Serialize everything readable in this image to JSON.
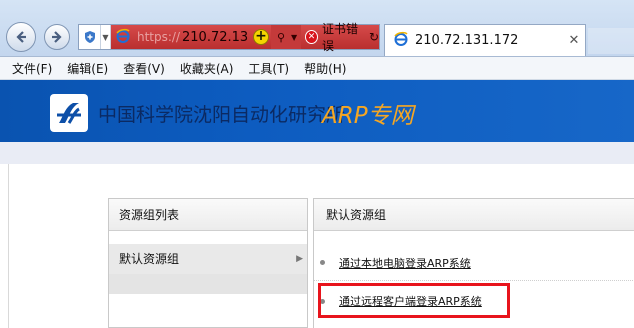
{
  "browser": {
    "address": {
      "url_prefix": "https://",
      "url_host": "210.72.13",
      "cert_error": "证书错误"
    },
    "tab": {
      "title": "210.72.131.172"
    },
    "menu": [
      "文件(F)",
      "编辑(E)",
      "查看(V)",
      "收藏夹(A)",
      "工具(T)",
      "帮助(H)"
    ]
  },
  "page": {
    "banner": {
      "org_name": "中国科学院沈阳自动化研究所",
      "product": "ARP专网"
    },
    "left_panel": {
      "header": "资源组列表",
      "items": [
        {
          "label": "默认资源组"
        }
      ]
    },
    "right_panel": {
      "header": "默认资源组",
      "links": [
        {
          "label": "通过本地电脑登录ARP系统"
        },
        {
          "label": "通过远程客户端登录ARP系统"
        }
      ]
    },
    "colors": {
      "banner_blue": "#0d5cc0",
      "accent_orange": "#f5a623",
      "cert_error_red": "#c43a3a",
      "highlight_red": "#e8141c"
    }
  }
}
